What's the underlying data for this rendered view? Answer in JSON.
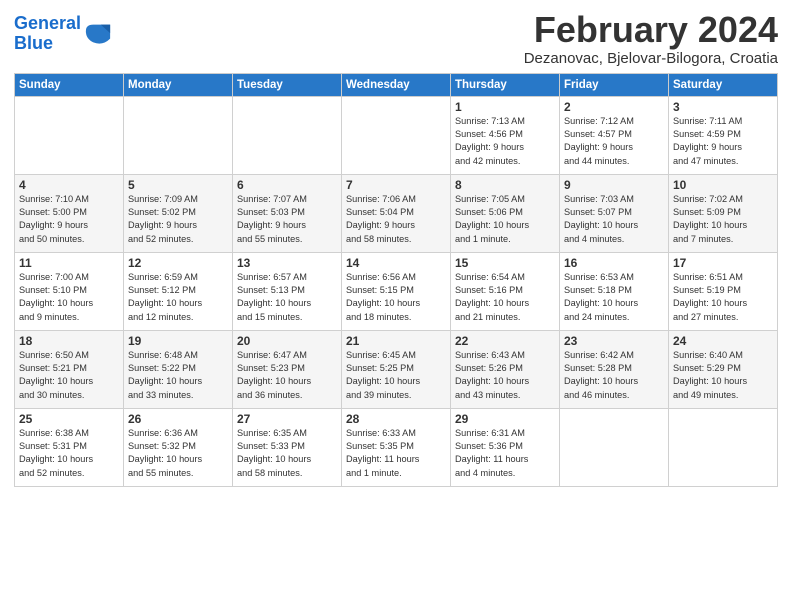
{
  "header": {
    "logo_line1": "General",
    "logo_line2": "Blue",
    "title": "February 2024",
    "subtitle": "Dezanovac, Bjelovar-Bilogora, Croatia"
  },
  "days_of_week": [
    "Sunday",
    "Monday",
    "Tuesday",
    "Wednesday",
    "Thursday",
    "Friday",
    "Saturday"
  ],
  "weeks": [
    [
      {
        "day": "",
        "info": ""
      },
      {
        "day": "",
        "info": ""
      },
      {
        "day": "",
        "info": ""
      },
      {
        "day": "",
        "info": ""
      },
      {
        "day": "1",
        "info": "Sunrise: 7:13 AM\nSunset: 4:56 PM\nDaylight: 9 hours\nand 42 minutes."
      },
      {
        "day": "2",
        "info": "Sunrise: 7:12 AM\nSunset: 4:57 PM\nDaylight: 9 hours\nand 44 minutes."
      },
      {
        "day": "3",
        "info": "Sunrise: 7:11 AM\nSunset: 4:59 PM\nDaylight: 9 hours\nand 47 minutes."
      }
    ],
    [
      {
        "day": "4",
        "info": "Sunrise: 7:10 AM\nSunset: 5:00 PM\nDaylight: 9 hours\nand 50 minutes."
      },
      {
        "day": "5",
        "info": "Sunrise: 7:09 AM\nSunset: 5:02 PM\nDaylight: 9 hours\nand 52 minutes."
      },
      {
        "day": "6",
        "info": "Sunrise: 7:07 AM\nSunset: 5:03 PM\nDaylight: 9 hours\nand 55 minutes."
      },
      {
        "day": "7",
        "info": "Sunrise: 7:06 AM\nSunset: 5:04 PM\nDaylight: 9 hours\nand 58 minutes."
      },
      {
        "day": "8",
        "info": "Sunrise: 7:05 AM\nSunset: 5:06 PM\nDaylight: 10 hours\nand 1 minute."
      },
      {
        "day": "9",
        "info": "Sunrise: 7:03 AM\nSunset: 5:07 PM\nDaylight: 10 hours\nand 4 minutes."
      },
      {
        "day": "10",
        "info": "Sunrise: 7:02 AM\nSunset: 5:09 PM\nDaylight: 10 hours\nand 7 minutes."
      }
    ],
    [
      {
        "day": "11",
        "info": "Sunrise: 7:00 AM\nSunset: 5:10 PM\nDaylight: 10 hours\nand 9 minutes."
      },
      {
        "day": "12",
        "info": "Sunrise: 6:59 AM\nSunset: 5:12 PM\nDaylight: 10 hours\nand 12 minutes."
      },
      {
        "day": "13",
        "info": "Sunrise: 6:57 AM\nSunset: 5:13 PM\nDaylight: 10 hours\nand 15 minutes."
      },
      {
        "day": "14",
        "info": "Sunrise: 6:56 AM\nSunset: 5:15 PM\nDaylight: 10 hours\nand 18 minutes."
      },
      {
        "day": "15",
        "info": "Sunrise: 6:54 AM\nSunset: 5:16 PM\nDaylight: 10 hours\nand 21 minutes."
      },
      {
        "day": "16",
        "info": "Sunrise: 6:53 AM\nSunset: 5:18 PM\nDaylight: 10 hours\nand 24 minutes."
      },
      {
        "day": "17",
        "info": "Sunrise: 6:51 AM\nSunset: 5:19 PM\nDaylight: 10 hours\nand 27 minutes."
      }
    ],
    [
      {
        "day": "18",
        "info": "Sunrise: 6:50 AM\nSunset: 5:21 PM\nDaylight: 10 hours\nand 30 minutes."
      },
      {
        "day": "19",
        "info": "Sunrise: 6:48 AM\nSunset: 5:22 PM\nDaylight: 10 hours\nand 33 minutes."
      },
      {
        "day": "20",
        "info": "Sunrise: 6:47 AM\nSunset: 5:23 PM\nDaylight: 10 hours\nand 36 minutes."
      },
      {
        "day": "21",
        "info": "Sunrise: 6:45 AM\nSunset: 5:25 PM\nDaylight: 10 hours\nand 39 minutes."
      },
      {
        "day": "22",
        "info": "Sunrise: 6:43 AM\nSunset: 5:26 PM\nDaylight: 10 hours\nand 43 minutes."
      },
      {
        "day": "23",
        "info": "Sunrise: 6:42 AM\nSunset: 5:28 PM\nDaylight: 10 hours\nand 46 minutes."
      },
      {
        "day": "24",
        "info": "Sunrise: 6:40 AM\nSunset: 5:29 PM\nDaylight: 10 hours\nand 49 minutes."
      }
    ],
    [
      {
        "day": "25",
        "info": "Sunrise: 6:38 AM\nSunset: 5:31 PM\nDaylight: 10 hours\nand 52 minutes."
      },
      {
        "day": "26",
        "info": "Sunrise: 6:36 AM\nSunset: 5:32 PM\nDaylight: 10 hours\nand 55 minutes."
      },
      {
        "day": "27",
        "info": "Sunrise: 6:35 AM\nSunset: 5:33 PM\nDaylight: 10 hours\nand 58 minutes."
      },
      {
        "day": "28",
        "info": "Sunrise: 6:33 AM\nSunset: 5:35 PM\nDaylight: 11 hours\nand 1 minute."
      },
      {
        "day": "29",
        "info": "Sunrise: 6:31 AM\nSunset: 5:36 PM\nDaylight: 11 hours\nand 4 minutes."
      },
      {
        "day": "",
        "info": ""
      },
      {
        "day": "",
        "info": ""
      }
    ]
  ]
}
